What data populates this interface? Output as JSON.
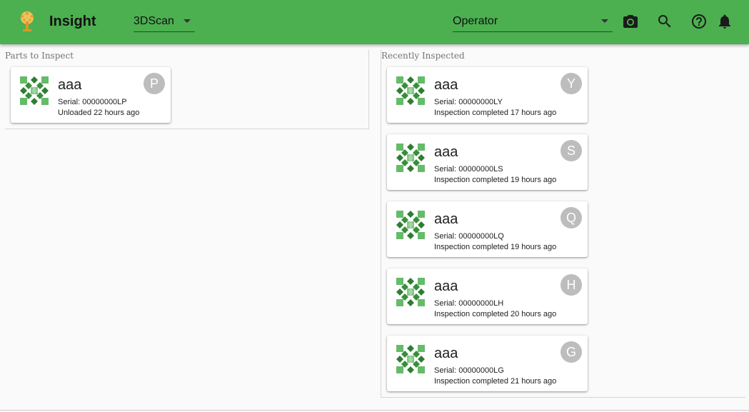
{
  "app": {
    "title": "Insight",
    "accent": "#4caf50"
  },
  "header": {
    "category_select": {
      "value": "3DScan"
    },
    "role_select": {
      "value": "Operator"
    },
    "icons": [
      "camera-icon",
      "search-icon",
      "help-icon",
      "bell-icon"
    ]
  },
  "parts_to_inspect": {
    "title": "Parts to Inspect",
    "items": [
      {
        "name": "aaa",
        "serial": "Serial: 00000000LP",
        "status": "Unloaded 22 hours ago",
        "avatar": "P"
      }
    ]
  },
  "recently_inspected": {
    "title": "Recently Inspected",
    "items": [
      {
        "name": "aaa",
        "serial": "Serial: 00000000LY",
        "status": "Inspection completed 17 hours ago",
        "avatar": "Y"
      },
      {
        "name": "aaa",
        "serial": "Serial: 00000000LS",
        "status": "Inspection completed 19 hours ago",
        "avatar": "S"
      },
      {
        "name": "aaa",
        "serial": "Serial: 00000000LQ",
        "status": "Inspection completed 19 hours ago",
        "avatar": "Q"
      },
      {
        "name": "aaa",
        "serial": "Serial: 00000000LH",
        "status": "Inspection completed 20 hours ago",
        "avatar": "H"
      },
      {
        "name": "aaa",
        "serial": "Serial: 00000000LG",
        "status": "Inspection completed 21 hours ago",
        "avatar": "G"
      }
    ]
  }
}
